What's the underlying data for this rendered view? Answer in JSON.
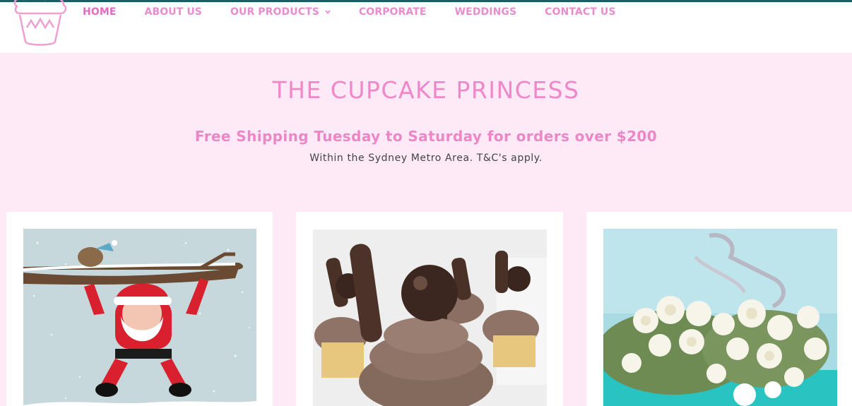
{
  "header": {
    "logo_icon": "cupcake-crown-logo",
    "nav": [
      {
        "label": "HOME",
        "active": true
      },
      {
        "label": "ABOUT US"
      },
      {
        "label": "OUR PRODUCTS",
        "dropdown": true
      },
      {
        "label": "CORPORATE"
      },
      {
        "label": "WEDDINGS"
      },
      {
        "label": "CONTACT US"
      }
    ]
  },
  "hero": {
    "title": "THE CUPCAKE PRINCESS",
    "shipping": "Free Shipping Tuesday to Saturday for orders over $200",
    "note": "Within the Sydney Metro Area. T&C's apply."
  },
  "colors": {
    "brand_pink": "#ef87c8",
    "nav_pink": "#e98bcf",
    "hero_bg": "#fdeaf6",
    "top_border": "#1b5f64"
  },
  "products": [
    {
      "image": "santa-christmas-illustration"
    },
    {
      "image": "chocolate-cupcakes"
    },
    {
      "image": "birthday-flower-cake"
    }
  ]
}
